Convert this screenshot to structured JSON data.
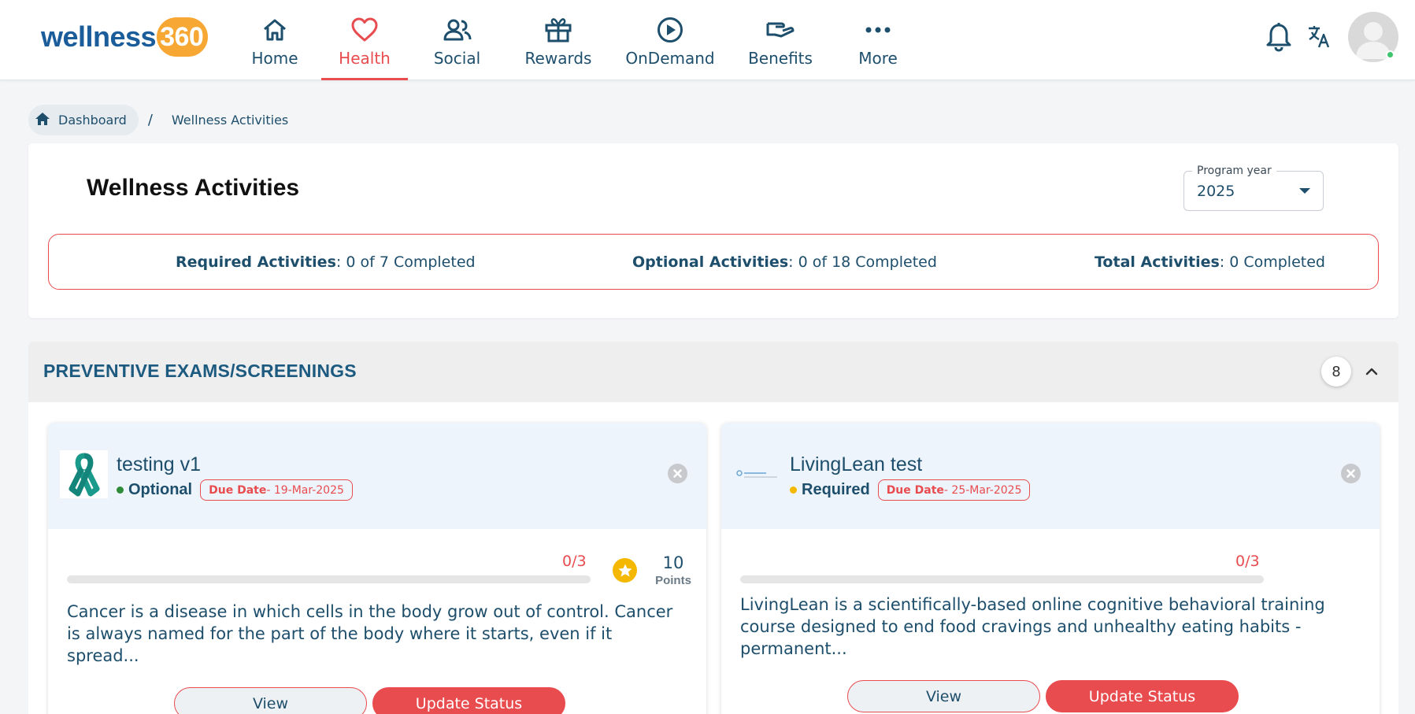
{
  "brand": {
    "name": "wellness",
    "suffix": "360"
  },
  "nav": [
    {
      "label": "Home",
      "icon": "home-icon"
    },
    {
      "label": "Health",
      "icon": "heart-icon",
      "active": true
    },
    {
      "label": "Social",
      "icon": "people-icon"
    },
    {
      "label": "Rewards",
      "icon": "gift-icon"
    },
    {
      "label": "OnDemand",
      "icon": "play-circle-icon"
    },
    {
      "label": "Benefits",
      "icon": "hand-icon"
    },
    {
      "label": "More",
      "icon": "more-dots-icon"
    }
  ],
  "header_icons": [
    "bell-icon",
    "translate-icon",
    "avatar"
  ],
  "breadcrumb": {
    "home": "Dashboard",
    "separator": "/",
    "current": "Wellness Activities"
  },
  "page": {
    "title": "Wellness Activities",
    "program_year": {
      "label": "Program year",
      "value": "2025"
    }
  },
  "stats": {
    "required": {
      "label": "Required Activities",
      "value": ": 0 of 7 Completed"
    },
    "optional": {
      "label": "Optional Activities",
      "value": ": 0 of 18 Completed"
    },
    "total": {
      "label": "Total Activities",
      "value": ": 0 Completed"
    }
  },
  "section": {
    "title": "PREVENTIVE EXAMS/SCREENINGS",
    "count": "8"
  },
  "cards": [
    {
      "title": "testing v1",
      "type": "Optional",
      "type_color": "#2e8b3a",
      "due_label": "Due Date",
      "due_value": " - 19-Mar-2025",
      "progress": "0/3",
      "progress_fraction": 0,
      "points": "10",
      "points_label": "Points",
      "description": "Cancer is a disease in which cells in the body grow out of control. Cancer is always named for the part of the body where it starts, even if it spread...",
      "view_label": "View",
      "update_label": "Update Status"
    },
    {
      "title": "LivingLean test",
      "type": "Required",
      "type_color": "#f5b800",
      "due_label": "Due Date",
      "due_value": " - 25-Mar-2025",
      "progress": "0/3",
      "progress_fraction": 0,
      "description": "LivingLean is a scientifically-based online cognitive behavioral training course designed to end food cravings and unhealthy eating habits - permanent...",
      "view_label": "View",
      "update_label": "Update Status"
    }
  ],
  "colors": {
    "accent": "#e84c4f",
    "primary_text": "#1d4e6b",
    "brand_blue": "#1b5d9a",
    "brand_orange": "#f7a733"
  }
}
